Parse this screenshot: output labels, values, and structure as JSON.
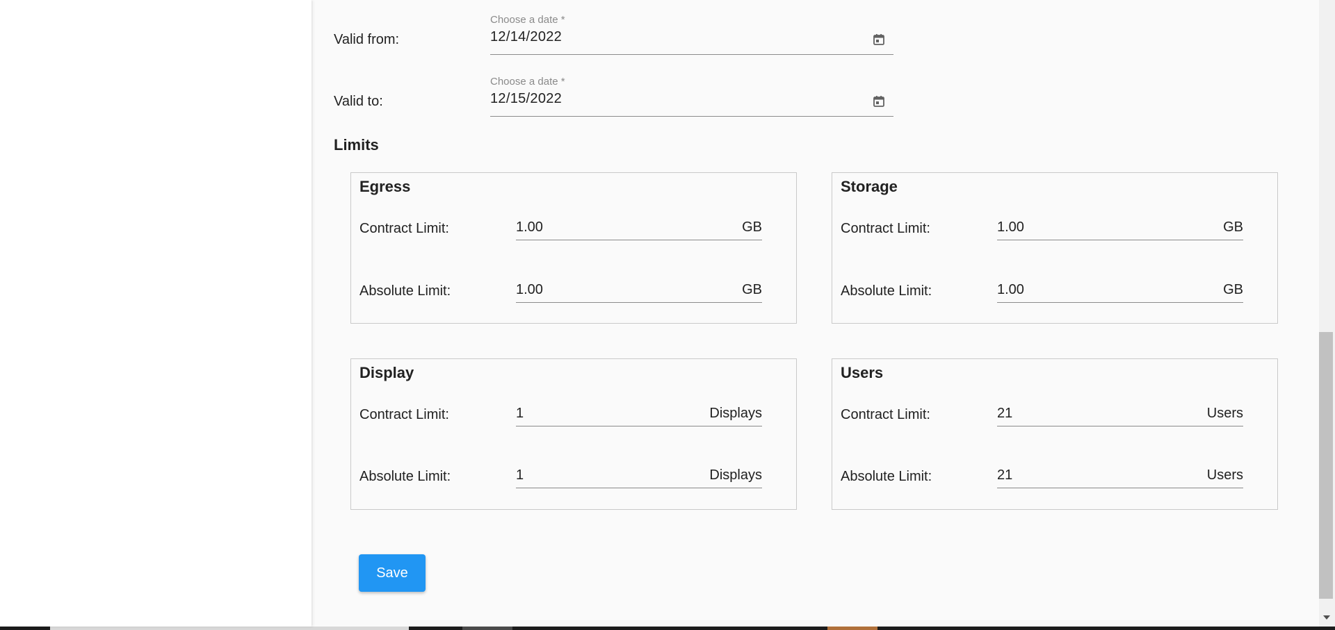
{
  "dates": {
    "valid_from": {
      "label": "Valid from:",
      "field_label": "Choose a date *",
      "value": "12/14/2022"
    },
    "valid_to": {
      "label": "Valid to:",
      "field_label": "Choose a date *",
      "value": "12/15/2022"
    },
    "calendar_icon": "calendar-icon"
  },
  "limits": {
    "title": "Limits",
    "contract_label": "Contract Limit:",
    "absolute_label": "Absolute Limit:",
    "cards": [
      {
        "title": "Egress",
        "contract_value": "1.00",
        "absolute_value": "1.00",
        "unit": "GB"
      },
      {
        "title": "Storage",
        "contract_value": "1.00",
        "absolute_value": "1.00",
        "unit": "GB"
      },
      {
        "title": "Display",
        "contract_value": "1",
        "absolute_value": "1",
        "unit": "Displays"
      },
      {
        "title": "Users",
        "contract_value": "21",
        "absolute_value": "21",
        "unit": "Users"
      }
    ]
  },
  "actions": {
    "save_label": "Save"
  },
  "colors": {
    "accent": "#2196f3",
    "background": "#fafafa"
  }
}
